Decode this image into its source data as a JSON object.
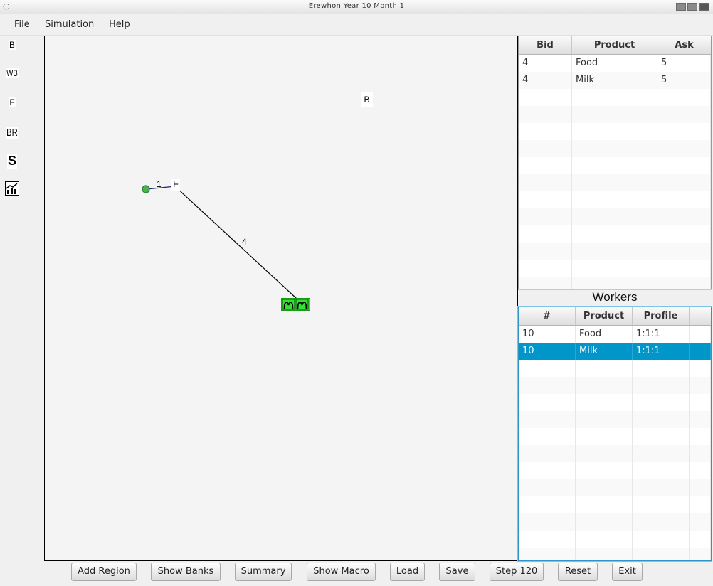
{
  "window": {
    "title": "Erewhon Year 10 Month 1"
  },
  "menu": {
    "file": "File",
    "simulation": "Simulation",
    "help": "Help"
  },
  "toolbar": {
    "bank": "B",
    "wholesale_bank": "WB",
    "factory": "F",
    "branch": "BR",
    "shop": "S"
  },
  "map": {
    "bank_label": "B",
    "factory_label": "F",
    "edge_short_label": "1",
    "edge_long_label": "4",
    "node_colors": {
      "market": "#33e033",
      "origin": "#4caf50",
      "short_edge": "#1a237e",
      "long_edge": "#000000"
    }
  },
  "market_table": {
    "headers": {
      "bid": "Bid",
      "product": "Product",
      "ask": "Ask"
    },
    "rows": [
      {
        "bid": "4",
        "product": "Food",
        "ask": "5"
      },
      {
        "bid": "4",
        "product": "Milk",
        "ask": "5"
      }
    ]
  },
  "workers": {
    "title": "Workers",
    "headers": {
      "count": "#",
      "product": "Product",
      "profile": "Profile"
    },
    "rows": [
      {
        "count": "10",
        "product": "Food",
        "profile": "1:1:1"
      },
      {
        "count": "10",
        "product": "Milk",
        "profile": "1:1:1"
      }
    ],
    "selected_row": 1,
    "selection_color": "#0096c9"
  },
  "buttons": {
    "add_region": "Add Region",
    "show_banks": "Show Banks",
    "summary": "Summary",
    "show_macro": "Show Macro",
    "load": "Load",
    "save": "Save",
    "step": "Step 120",
    "reset": "Reset",
    "exit": "Exit"
  }
}
